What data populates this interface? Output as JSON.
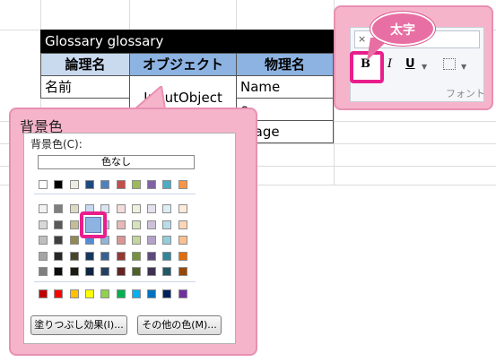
{
  "table": {
    "title": "Glossary glossary",
    "headers": [
      "論理名",
      "オブジェクト",
      "物理名"
    ],
    "rows": [
      {
        "logical": "名前",
        "physical": "Name"
      },
      {
        "logical": "",
        "physical": "e"
      },
      {
        "logical": "",
        "physical": "ssage"
      }
    ],
    "merged_object": "InputObject"
  },
  "fill_panel": {
    "title": "背景色",
    "label": "背景色(C):",
    "no_fill": "色なし",
    "fill_effects_button": "塗りつぶし効果(I)...",
    "more_colors_button": "その他の色(M)..."
  },
  "ribbon": {
    "bubble_label": "太字",
    "bold_glyph": "B",
    "italic_glyph": "I",
    "underline_glyph": "U",
    "group_label": "フォント",
    "input_value": "×"
  },
  "colors": {
    "accent": "#e91e8c",
    "callout": "#f6b4cb",
    "header_blue": "#8db3e2",
    "selected_color": "#8db3e2"
  }
}
